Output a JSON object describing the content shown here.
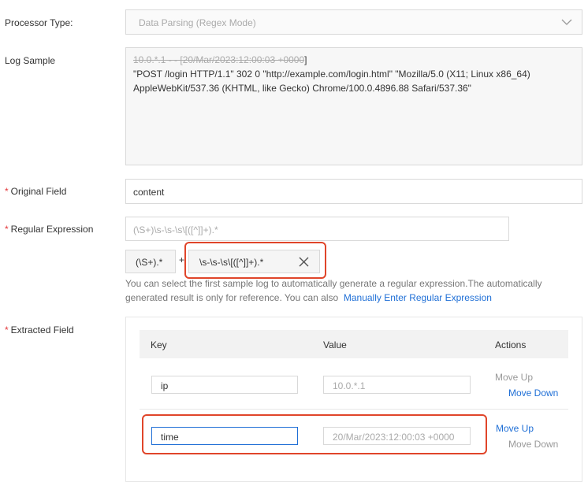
{
  "form": {
    "processor_type": {
      "label": "Processor Type:",
      "value": "Data Parsing (Regex Mode)"
    },
    "log_sample": {
      "label": "Log Sample",
      "line1_struck": "10.0.*.1 - - [20/Mar/2023:12:00:03 +0000",
      "line1_rest": "]",
      "line2": "\"POST /login HTTP/1.1\" 302 0 \"http://example.com/login.html\" \"Mozilla/5.0 (X11; Linux x86_64)",
      "line3": "AppleWebKit/537.36 (KHTML, like Gecko) Chrome/100.0.4896.88 Safari/537.36\""
    },
    "original_field": {
      "required": "*",
      "label": "Original Field",
      "value": "content"
    },
    "regular_expression": {
      "required": "*",
      "label": "Regular Expression",
      "value": "(\\S+)\\s-\\s-\\s\\[([^]]+).*",
      "segments": [
        "(\\S+).*",
        "\\s-\\s-\\s\\[([^]]+).*"
      ],
      "plus": "+",
      "help_line1": "You can select the first sample log to automatically generate a regular expression.The automatically",
      "help_line2": "generated result is only for reference. You can also",
      "help_link": "Manually Enter Regular Expression"
    },
    "extracted_field": {
      "required": "*",
      "label": "Extracted Field",
      "columns": {
        "key": "Key",
        "value": "Value",
        "actions": "Actions"
      },
      "rows": [
        {
          "key": "ip",
          "value": "10.0.*.1",
          "move_up": "Move Up",
          "move_down": "Move Down",
          "up_enabled": false,
          "down_enabled": true
        },
        {
          "key": "time",
          "value": "20/Mar/2023:12:00:03 +0000",
          "move_up": "Move Up",
          "move_down": "Move Down",
          "up_enabled": true,
          "down_enabled": false
        }
      ]
    }
  },
  "colors": {
    "highlight": "#e0452a",
    "link": "#1f6fd6",
    "required": "#e4393c"
  },
  "icons": {
    "select": "chevron-down-icon",
    "segment_remove": "close-icon"
  }
}
